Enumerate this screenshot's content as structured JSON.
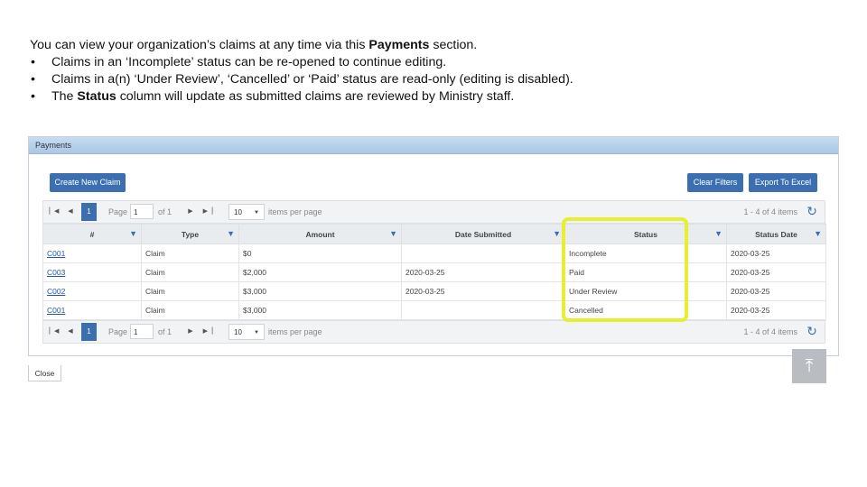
{
  "intro": {
    "line1_pre": "You can view your organization’s claims at any time via this ",
    "line1_bold": "Payments",
    "line1_post": " section.",
    "bullet_char": "•",
    "bullet1": "Claims in an ‘Incomplete’ status can be re-opened to continue editing.",
    "bullet2": "Claims in a(n) ‘Under Review’, ‘Cancelled’ or ‘Paid’ status are read-only (editing is disabled).",
    "bullet3_pre": "The ",
    "bullet3_bold": "Status",
    "bullet3_post": " column will update as submitted claims are reviewed by Ministry staff."
  },
  "panel": {
    "title": "Payments"
  },
  "toolbar": {
    "create_label": "Create New Claim",
    "clear_label": "Clear Filters",
    "export_label": "Export To Excel"
  },
  "pager": {
    "page_label": "Page",
    "page_value": "1",
    "of_label": "of 1",
    "current_page": "1",
    "page_size": "10",
    "items_per_page": "items per page",
    "info": "1 - 4 of 4 items"
  },
  "table": {
    "headers": {
      "num": "#",
      "type": "Type",
      "amount": "Amount",
      "date_submitted": "Date Submitted",
      "status": "Status",
      "status_date": "Status Date"
    },
    "rows": [
      {
        "id": "C001",
        "type": "Claim",
        "amount": "$0",
        "date_submitted": "",
        "status": "Incomplete",
        "status_date": "2020-03-25"
      },
      {
        "id": "C003",
        "type": "Claim",
        "amount": "$2,000",
        "date_submitted": "2020-03-25",
        "status": "Paid",
        "status_date": "2020-03-25"
      },
      {
        "id": "C002",
        "type": "Claim",
        "amount": "$3,000",
        "date_submitted": "2020-03-25",
        "status": "Under Review",
        "status_date": "2020-03-25"
      },
      {
        "id": "C001",
        "type": "Claim",
        "amount": "$3,000",
        "date_submitted": "",
        "status": "Cancelled",
        "status_date": "2020-03-25"
      }
    ]
  },
  "close_label": "Close",
  "colors": {
    "accent": "#3c6fb0",
    "highlight": "#e6ef32",
    "header_bar": "#b9d2ec"
  }
}
